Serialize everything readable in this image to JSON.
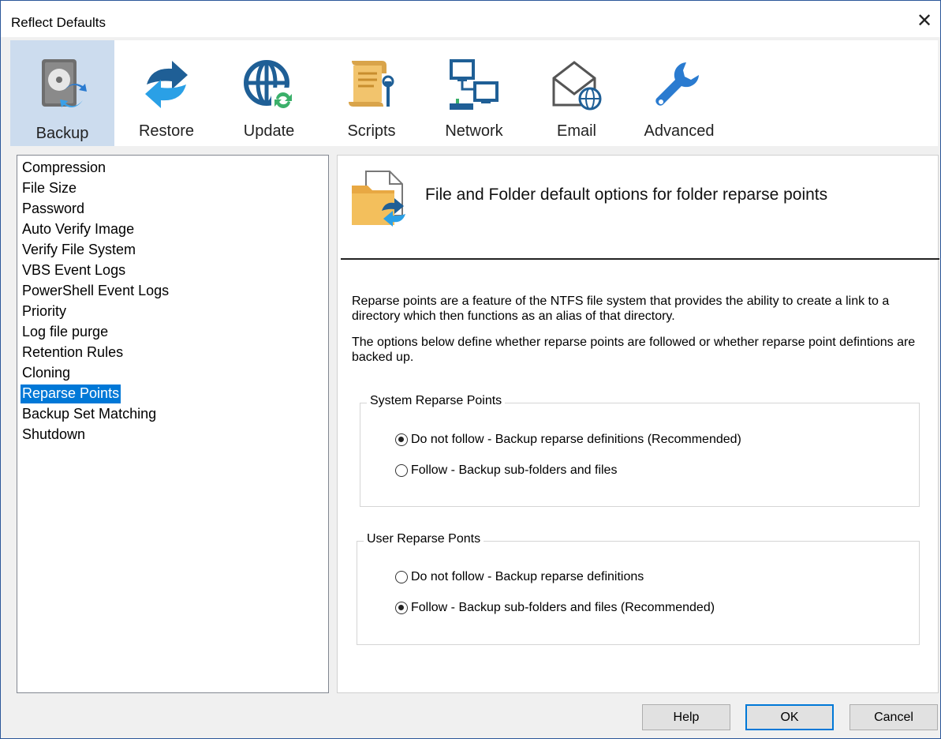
{
  "window": {
    "title": "Reflect Defaults"
  },
  "toolbar": {
    "items": [
      {
        "label": "Backup",
        "icon": "backup-disk-icon",
        "selected": true
      },
      {
        "label": "Restore",
        "icon": "restore-arrows-icon",
        "selected": false
      },
      {
        "label": "Update",
        "icon": "update-globe-icon",
        "selected": false
      },
      {
        "label": "Scripts",
        "icon": "scripts-scroll-icon",
        "selected": false
      },
      {
        "label": "Network",
        "icon": "network-computers-icon",
        "selected": false
      },
      {
        "label": "Email",
        "icon": "email-envelope-icon",
        "selected": false
      },
      {
        "label": "Advanced",
        "icon": "wrench-icon",
        "selected": false
      }
    ]
  },
  "sidebar": {
    "items": [
      "Compression",
      "File Size",
      "Password",
      "Auto Verify Image",
      "Verify File System",
      "VBS Event Logs",
      "PowerShell Event Logs",
      "Priority",
      "Log file purge",
      "Retention Rules",
      "Cloning",
      "Reparse Points",
      "Backup Set Matching",
      "Shutdown"
    ],
    "selected": "Reparse Points"
  },
  "content": {
    "header": "File and Folder default options for folder reparse points",
    "description1": "Reparse points are a feature of the NTFS file system that provides the ability to create a link to a directory which then functions as an alias of that directory.",
    "description2": "The options below  define whether reparse points are followed or whether reparse point defintions are backed up.",
    "system_group": {
      "legend": "System Reparse Points",
      "options": [
        {
          "label": "Do not follow - Backup reparse definitions (Recommended)",
          "checked": true
        },
        {
          "label": "Follow - Backup sub-folders and files",
          "checked": false
        }
      ]
    },
    "user_group": {
      "legend": "User Reparse Ponts",
      "options": [
        {
          "label": "Do not follow - Backup reparse definitions",
          "checked": false
        },
        {
          "label": "Follow - Backup sub-folders and files (Recommended)",
          "checked": true
        }
      ]
    }
  },
  "buttons": {
    "help": "Help",
    "ok": "OK",
    "cancel": "Cancel"
  },
  "colors": {
    "selection": "#0078d7",
    "toolbar_selected": "#ccdcee"
  }
}
